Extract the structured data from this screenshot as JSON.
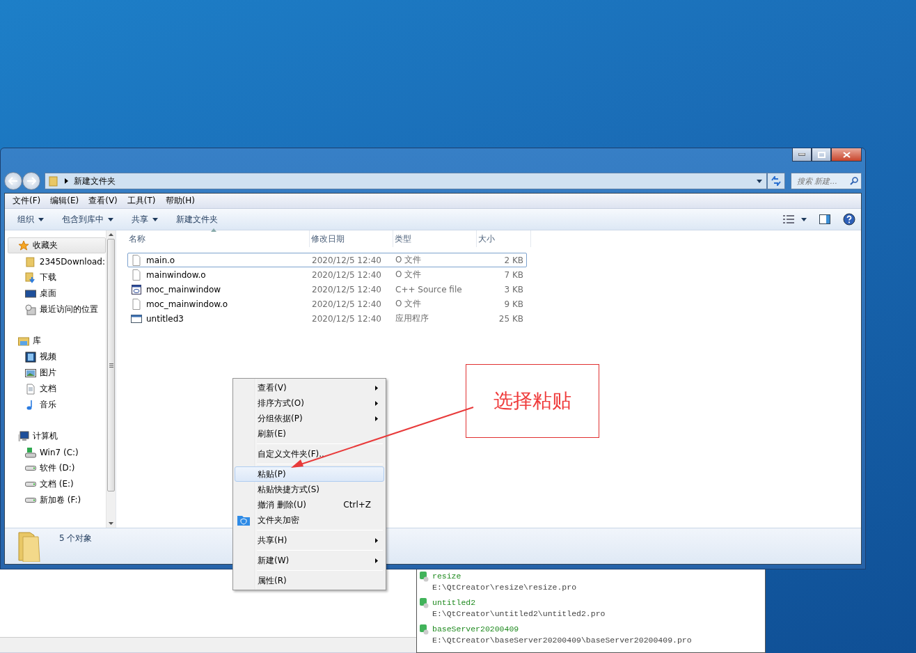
{
  "explorer": {
    "address": {
      "path": "新建文件夹"
    },
    "search": {
      "placeholder": "搜索 新建..."
    },
    "menu_bar": [
      "文件(F)",
      "编辑(E)",
      "查看(V)",
      "工具(T)",
      "帮助(H)"
    ],
    "command_bar": [
      {
        "label": "组织",
        "dropdown": true
      },
      {
        "label": "包含到库中",
        "dropdown": true
      },
      {
        "label": "共享",
        "dropdown": true
      },
      {
        "label": "新建文件夹",
        "dropdown": false
      }
    ],
    "navigation": [
      {
        "label": "收藏夹",
        "selected": true,
        "children": [
          {
            "label": "2345Download:"
          },
          {
            "label": "下载"
          },
          {
            "label": "桌面"
          },
          {
            "label": "最近访问的位置"
          }
        ]
      },
      {
        "label": "库",
        "selected": false,
        "children": [
          {
            "label": "视频"
          },
          {
            "label": "图片"
          },
          {
            "label": "文档"
          },
          {
            "label": "音乐"
          }
        ]
      },
      {
        "label": "计算机",
        "selected": false,
        "children": [
          {
            "label": "Win7 (C:)"
          },
          {
            "label": "软件 (D:)"
          },
          {
            "label": "文档 (E:)"
          },
          {
            "label": "新加卷 (F:)"
          }
        ]
      }
    ],
    "columns": [
      "名称",
      "修改日期",
      "类型",
      "大小"
    ],
    "files": [
      {
        "name": "main.o",
        "modified": "2020/12/5 12:40",
        "type": "O 文件",
        "size": "2 KB",
        "kind": "blank",
        "selected": true
      },
      {
        "name": "mainwindow.o",
        "modified": "2020/12/5 12:40",
        "type": "O 文件",
        "size": "7 KB",
        "kind": "blank",
        "selected": false
      },
      {
        "name": "moc_mainwindow",
        "modified": "2020/12/5 12:40",
        "type": "C++ Source file",
        "size": "3 KB",
        "kind": "source",
        "selected": false
      },
      {
        "name": "moc_mainwindow.o",
        "modified": "2020/12/5 12:40",
        "type": "O 文件",
        "size": "9 KB",
        "kind": "blank",
        "selected": false
      },
      {
        "name": "untitled3",
        "modified": "2020/12/5 12:40",
        "type": "应用程序",
        "size": "25 KB",
        "kind": "app",
        "selected": false
      }
    ],
    "status": "5 个对象"
  },
  "context_menu": {
    "groups": [
      [
        {
          "label": "查看(V)",
          "submenu": true,
          "highlighted": false
        },
        {
          "label": "排序方式(O)",
          "submenu": true,
          "highlighted": false
        },
        {
          "label": "分组依据(P)",
          "submenu": true,
          "highlighted": false
        },
        {
          "label": "刷新(E)",
          "submenu": false,
          "highlighted": false
        }
      ],
      [
        {
          "label": "自定义文件夹(F)...",
          "submenu": false,
          "highlighted": false
        }
      ],
      [
        {
          "label": "粘贴(P)",
          "submenu": false,
          "highlighted": true
        },
        {
          "label": "粘贴快捷方式(S)",
          "submenu": false,
          "highlighted": false
        },
        {
          "label": "撤消 删除(U)",
          "shortcut": "Ctrl+Z",
          "submenu": false,
          "highlighted": false
        },
        {
          "label": "文件夹加密",
          "submenu": false,
          "highlighted": false
        }
      ],
      [
        {
          "label": "共享(H)",
          "submenu": true,
          "highlighted": false
        }
      ],
      [
        {
          "label": "新建(W)",
          "submenu": true,
          "highlighted": false
        }
      ],
      [
        {
          "label": "属性(R)",
          "submenu": false,
          "highlighted": false
        }
      ]
    ]
  },
  "annotation": {
    "text": "选择粘贴"
  },
  "recent_projects": [
    {
      "name": "resize",
      "path": "E:\\QtCreator\\resize\\resize.pro"
    },
    {
      "name": "untitled2",
      "path": "E:\\QtCreator\\untitled2\\untitled2.pro"
    },
    {
      "name": "baseServer20200409",
      "path": "E:\\QtCreator\\baseServer20200409\\baseServer20200409.pro"
    }
  ]
}
